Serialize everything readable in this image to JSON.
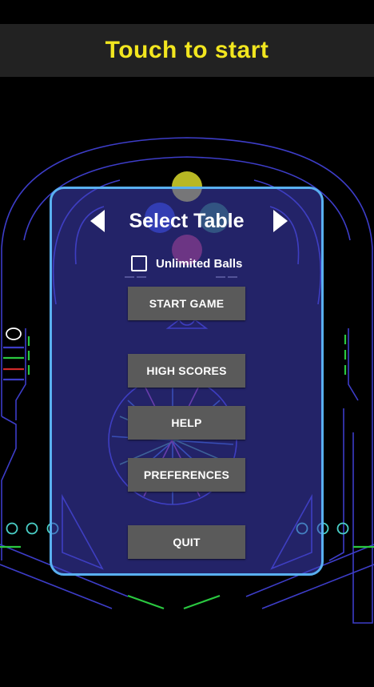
{
  "banner": {
    "text": "Touch to start"
  },
  "panel": {
    "title": "Select Table",
    "unlimited_balls": {
      "label": "Unlimited Balls",
      "checked": false
    },
    "buttons": {
      "start_game": "START GAME",
      "high_scores": "HIGH SCORES",
      "help": "HELP",
      "preferences": "PREFERENCES",
      "quit": "QUIT"
    }
  },
  "colors": {
    "banner_text": "#f2e61f",
    "banner_bg": "#222222",
    "panel_border": "#59b0f0",
    "button_bg": "#5a5a5a",
    "table_lines": "#3d3dc8",
    "bumper_yellow": "#d8d82a",
    "bumper_red": "#c0304a",
    "bumper_green": "#2a8a4a",
    "bumper_blue": "#2a4ad0"
  }
}
